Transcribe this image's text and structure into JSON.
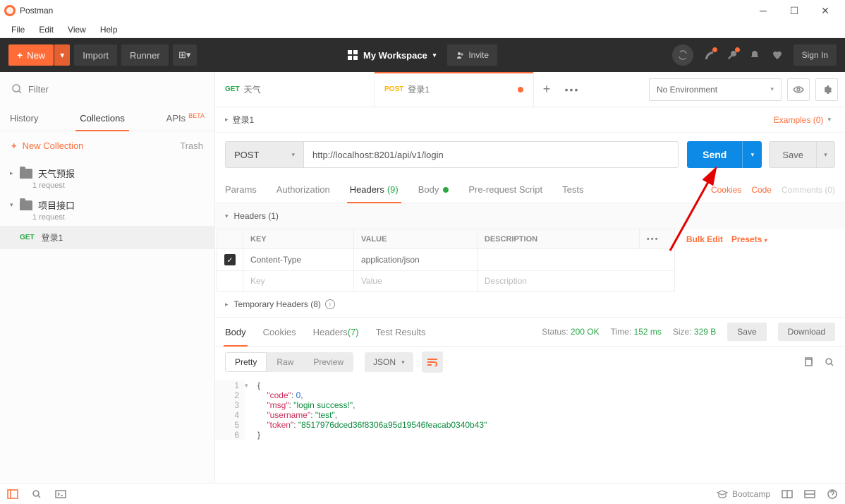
{
  "window": {
    "title": "Postman"
  },
  "menu": {
    "file": "File",
    "edit": "Edit",
    "view": "View",
    "help": "Help"
  },
  "toolbar": {
    "new": "New",
    "import": "Import",
    "runner": "Runner",
    "workspace": "My Workspace",
    "invite": "Invite",
    "signin": "Sign In"
  },
  "sidebar": {
    "filter_placeholder": "Filter",
    "tabs": {
      "history": "History",
      "collections": "Collections",
      "apis": "APIs",
      "beta": "BETA"
    },
    "new_collection": "New Collection",
    "trash": "Trash",
    "collections": [
      {
        "name": "天气预报",
        "sub": "1 request"
      },
      {
        "name": "项目接口",
        "sub": "1 request"
      }
    ],
    "active_request": {
      "method": "GET",
      "name": "登录1"
    }
  },
  "request_tabs": [
    {
      "method": "GET",
      "method_class": "get",
      "name": "天气",
      "active": false,
      "unsaved": false
    },
    {
      "method": "POST",
      "method_class": "post",
      "name": "登录1",
      "active": true,
      "unsaved": true
    }
  ],
  "environment": {
    "selected": "No Environment"
  },
  "breadcrumb": {
    "name": "登录1",
    "examples": "Examples (0)"
  },
  "request": {
    "method": "POST",
    "url": "http://localhost:8201/api/v1/login",
    "send": "Send",
    "save": "Save"
  },
  "req_tabs": {
    "params": "Params",
    "auth": "Authorization",
    "headers": "Headers",
    "headers_count": "(9)",
    "body": "Body",
    "prereq": "Pre-request Script",
    "tests": "Tests",
    "cookies": "Cookies",
    "code": "Code",
    "comments": "Comments (0)"
  },
  "headers_section": {
    "title": "Headers (1)",
    "cols": {
      "key": "KEY",
      "value": "VALUE",
      "desc": "DESCRIPTION",
      "bulk": "Bulk Edit",
      "presets": "Presets"
    },
    "rows": [
      {
        "checked": true,
        "key": "Content-Type",
        "value": "application/json",
        "desc": ""
      }
    ],
    "placeholder": {
      "key": "Key",
      "value": "Value",
      "desc": "Description"
    },
    "temp": "Temporary Headers (8)"
  },
  "response": {
    "tabs": {
      "body": "Body",
      "cookies": "Cookies",
      "headers": "Headers",
      "headers_count": "(7)",
      "tests": "Test Results"
    },
    "status_label": "Status:",
    "status": "200 OK",
    "time_label": "Time:",
    "time": "152 ms",
    "size_label": "Size:",
    "size": "329 B",
    "save": "Save",
    "download": "Download",
    "view": {
      "pretty": "Pretty",
      "raw": "Raw",
      "preview": "Preview",
      "format": "JSON"
    },
    "body_json": {
      "code": 0,
      "msg": "login success!",
      "username": "test",
      "token": "8517976dced36f8306a95d19546feacab0340b43"
    }
  },
  "statusbar": {
    "bootcamp": "Bootcamp"
  }
}
